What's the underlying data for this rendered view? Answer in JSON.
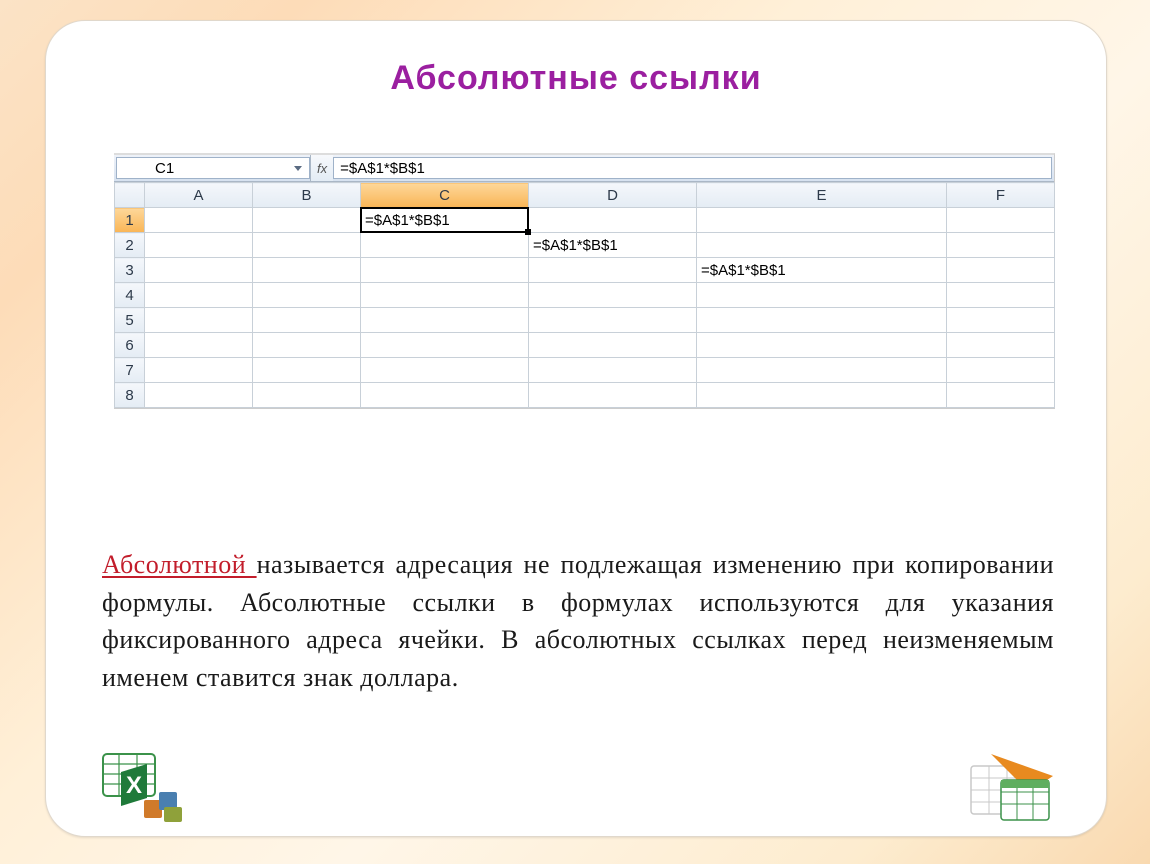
{
  "title": "Абсолютные ссылки",
  "excel": {
    "namebox_value": "C1",
    "fx_label": "fx",
    "formula": "=$A$1*$B$1",
    "column_headers": [
      "A",
      "B",
      "C",
      "D",
      "E",
      "F"
    ],
    "row_headers": [
      "1",
      "2",
      "3",
      "4",
      "5",
      "6",
      "7",
      "8"
    ],
    "active_column_index": 2,
    "active_row_index": 0,
    "cells": {
      "C1": "=$A$1*$B$1",
      "D2": "=$A$1*$B$1",
      "E3": "=$A$1*$B$1"
    }
  },
  "body": {
    "lead": "Абсолютной ",
    "rest": "называется адресация не подлежащая изменению при копировании формулы. Абсолютные ссылки в формулах используются для указания фиксированного адреса ячейки. В абсолютных ссылках перед неизменяемым именем ставится знак доллара."
  },
  "icons": {
    "left": "excel-2010-icon",
    "right": "excel-2007-icon"
  }
}
